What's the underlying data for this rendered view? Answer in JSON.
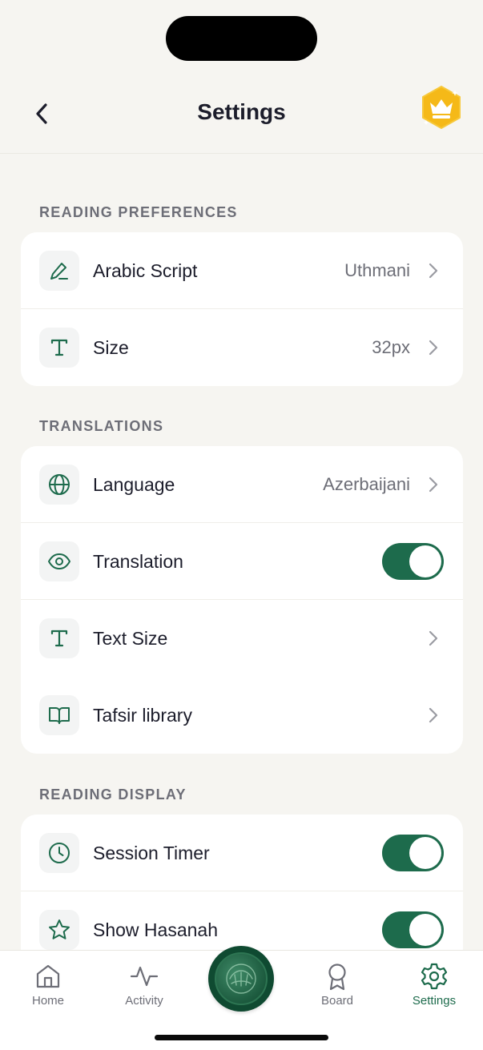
{
  "header": {
    "title": "Settings"
  },
  "sections": [
    {
      "label": "READING PREFERENCES",
      "rows": [
        {
          "icon": "pencil-icon",
          "label": "Arabic Script",
          "value": "Uthmani"
        },
        {
          "icon": "text-size-icon",
          "label": "Size",
          "value": "32px"
        }
      ]
    },
    {
      "label": "TRANSLATIONS",
      "rows": [
        {
          "icon": "globe-icon",
          "label": "Language",
          "value": "Azerbaijani"
        },
        {
          "icon": "eye-icon",
          "label": "Translation",
          "toggle": true
        },
        {
          "icon": "text-size-icon",
          "label": "Text Size"
        },
        {
          "icon": "book-open-icon",
          "label": "Tafsir library"
        }
      ]
    },
    {
      "label": "READING DISPLAY",
      "rows": [
        {
          "icon": "clock-icon",
          "label": "Session Timer",
          "toggle": true
        },
        {
          "icon": "star-icon",
          "label": "Show Hasanah",
          "toggle": true
        }
      ]
    }
  ],
  "tabbar": {
    "tabs": [
      {
        "icon": "home-icon",
        "label": "Home"
      },
      {
        "icon": "activity-icon",
        "label": "Activity"
      },
      {
        "icon": "quran-icon",
        "label": ""
      },
      {
        "icon": "award-icon",
        "label": "Board"
      },
      {
        "icon": "gear-icon",
        "label": "Settings",
        "active": true
      }
    ]
  },
  "colors": {
    "accent": "#1d6b4c",
    "background": "#f6f5f1",
    "premium": "#f5b918"
  }
}
